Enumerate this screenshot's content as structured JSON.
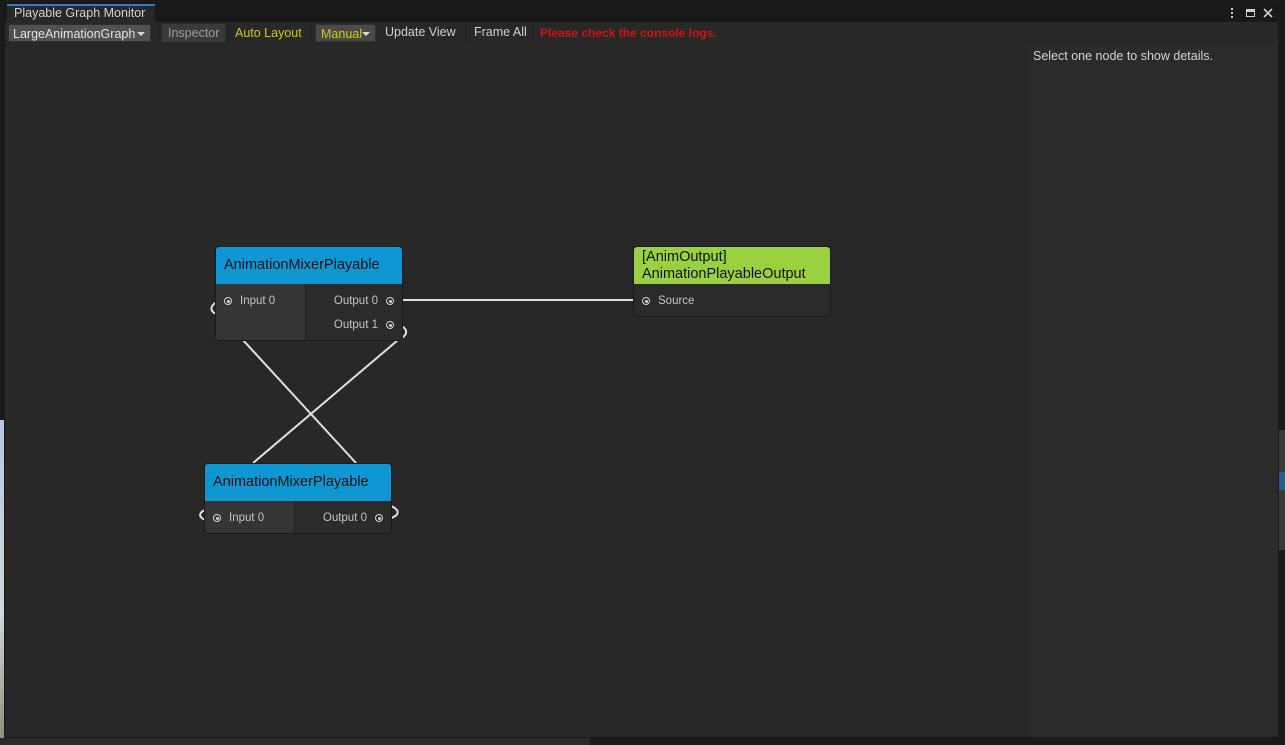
{
  "window": {
    "title": "Playable Graph Monitor"
  },
  "toolbar": {
    "graph_select": "LargeAnimationGraph",
    "inspector": "Inspector",
    "auto_layout": "Auto Layout",
    "layout_mode": "Manual",
    "update_view": "Update View",
    "frame_all": "Frame All",
    "error_message": "Please check the console logs."
  },
  "colors": {
    "mixer_header": "#0f97d4",
    "output_header": "#9bd13f",
    "error_text": "#d01414",
    "highlight_text": "#d6c514",
    "tab_accent": "#3a79bb"
  },
  "nodes": {
    "mixer_top": {
      "title": "AnimationMixerPlayable",
      "inputs": [
        "Input 0"
      ],
      "outputs": [
        "Output 0",
        "Output 1"
      ]
    },
    "output_node": {
      "title_line1": "[AnimOutput]",
      "title_line2": "AnimationPlayableOutput",
      "inputs": [
        "Source"
      ]
    },
    "mixer_bottom": {
      "title": "AnimationMixerPlayable",
      "inputs": [
        "Input 0"
      ],
      "outputs": [
        "Output 0"
      ]
    }
  },
  "inspector": {
    "message": "Select one node to show details."
  },
  "icons": [
    "kebab-menu-icon",
    "maximize-icon",
    "close-icon",
    "dropdown-arrow-icon",
    "port-connector-icon"
  ]
}
